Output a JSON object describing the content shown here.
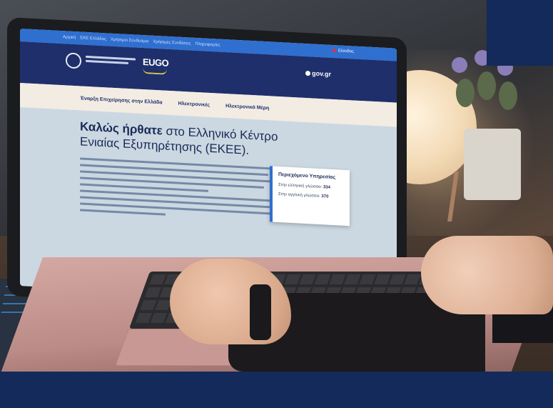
{
  "screen": {
    "top_nav": [
      "Αρχική",
      "ΕΚΕ Ελλάδας",
      "Χρήσιμοι Σύνδεσμοι",
      "Χρήσιμες Συνδέσεις",
      "Πληροφορίες"
    ],
    "login_label": "Είσοδος",
    "brand": {
      "eugo_logo": "EUGO",
      "gov_gr": "gov.gr"
    },
    "menu": [
      "Έναρξη Επιχείρησης στην Ελλάδα",
      "Ηλεκτρονικές",
      "Ηλεκτρονικά Μέρη"
    ],
    "hero": {
      "title_bold": "Καλώς ήρθατε",
      "title_rest": "στο Ελληνικό Κέντρο Ενιαίας Εξυπηρέτησης (ΕΚΕΕ)."
    },
    "contact_card": {
      "title": "Περιεχόμενο Υπηρεσίας",
      "line1_label": "Στην ελληνική γλώσσα:",
      "line1_value": "334",
      "line2_label": "Στην αγγλική γλώσσα:",
      "line2_value": "370"
    }
  },
  "colors": {
    "brand_navy": "#132a5a",
    "site_blue": "#2f6fd0",
    "site_header": "#1e2f6b"
  }
}
